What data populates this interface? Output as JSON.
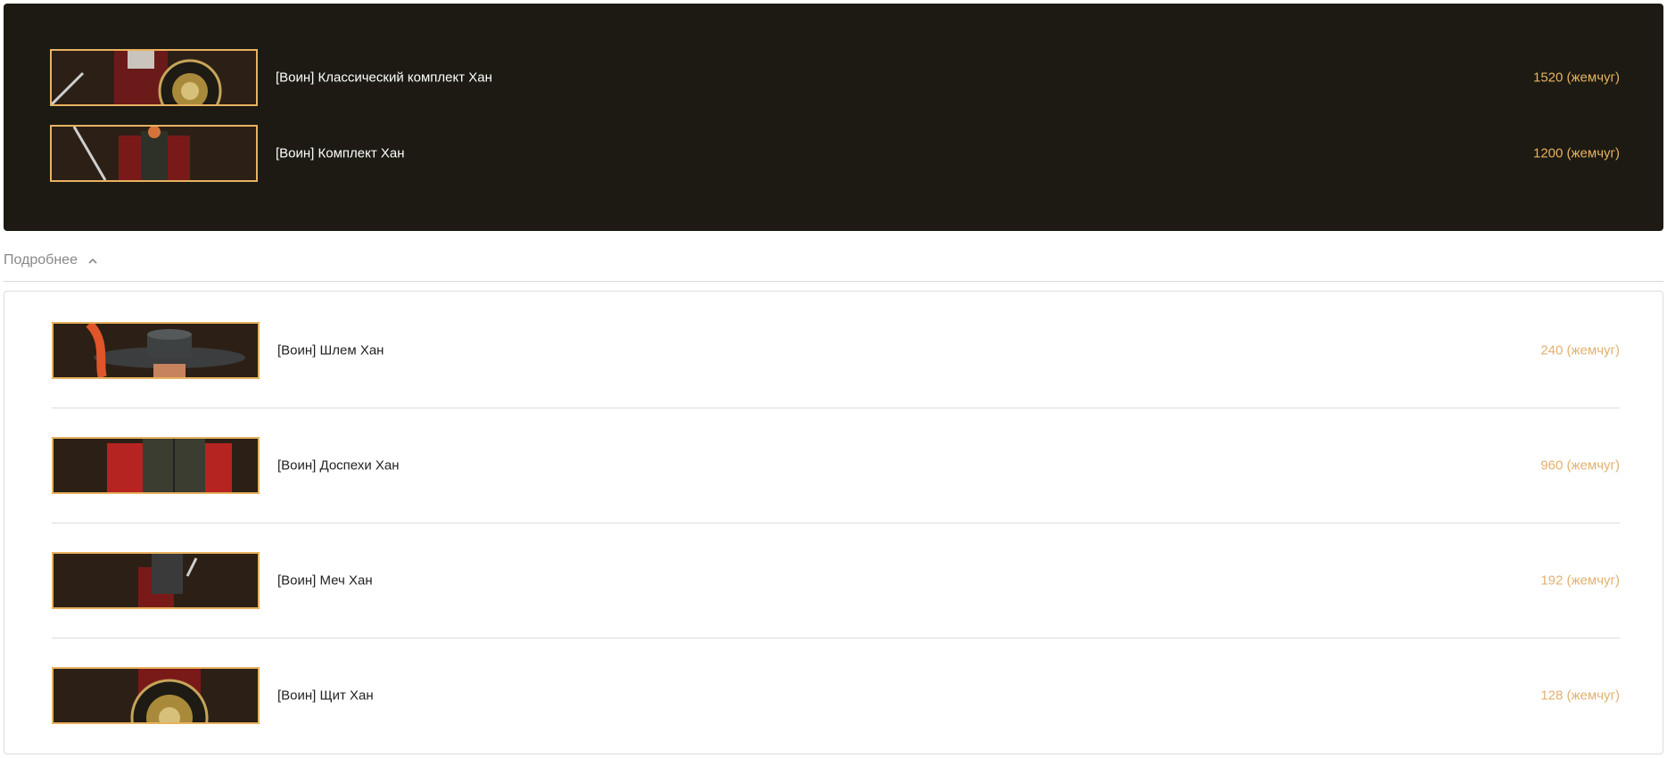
{
  "sets": [
    {
      "name": "[Воин] Классический комплект Хан",
      "price": "1520 (жемчуг)",
      "image": "set-classic-han-image"
    },
    {
      "name": "[Воин] Комплект Хан",
      "price": "1200 (жемчуг)",
      "image": "set-han-image"
    }
  ],
  "details_toggle": {
    "label": "Подробнее",
    "icon": "chevron-up-icon"
  },
  "items": [
    {
      "name": "[Воин] Шлем Хан",
      "price": "240 (жемчуг)",
      "image": "helmet-image"
    },
    {
      "name": "[Воин] Доспехи Хан",
      "price": "960 (жемчуг)",
      "image": "armor-image"
    },
    {
      "name": "[Воин] Меч Хан",
      "price": "192 (жемчуг)",
      "image": "sword-image"
    },
    {
      "name": "[Воин] Щит Хан",
      "price": "128 (жемчуг)",
      "image": "shield-image"
    }
  ],
  "colors": {
    "dark_panel_bg": "#1c1a13",
    "gold_accent": "#e8b260",
    "price_light": "#e3b070"
  }
}
